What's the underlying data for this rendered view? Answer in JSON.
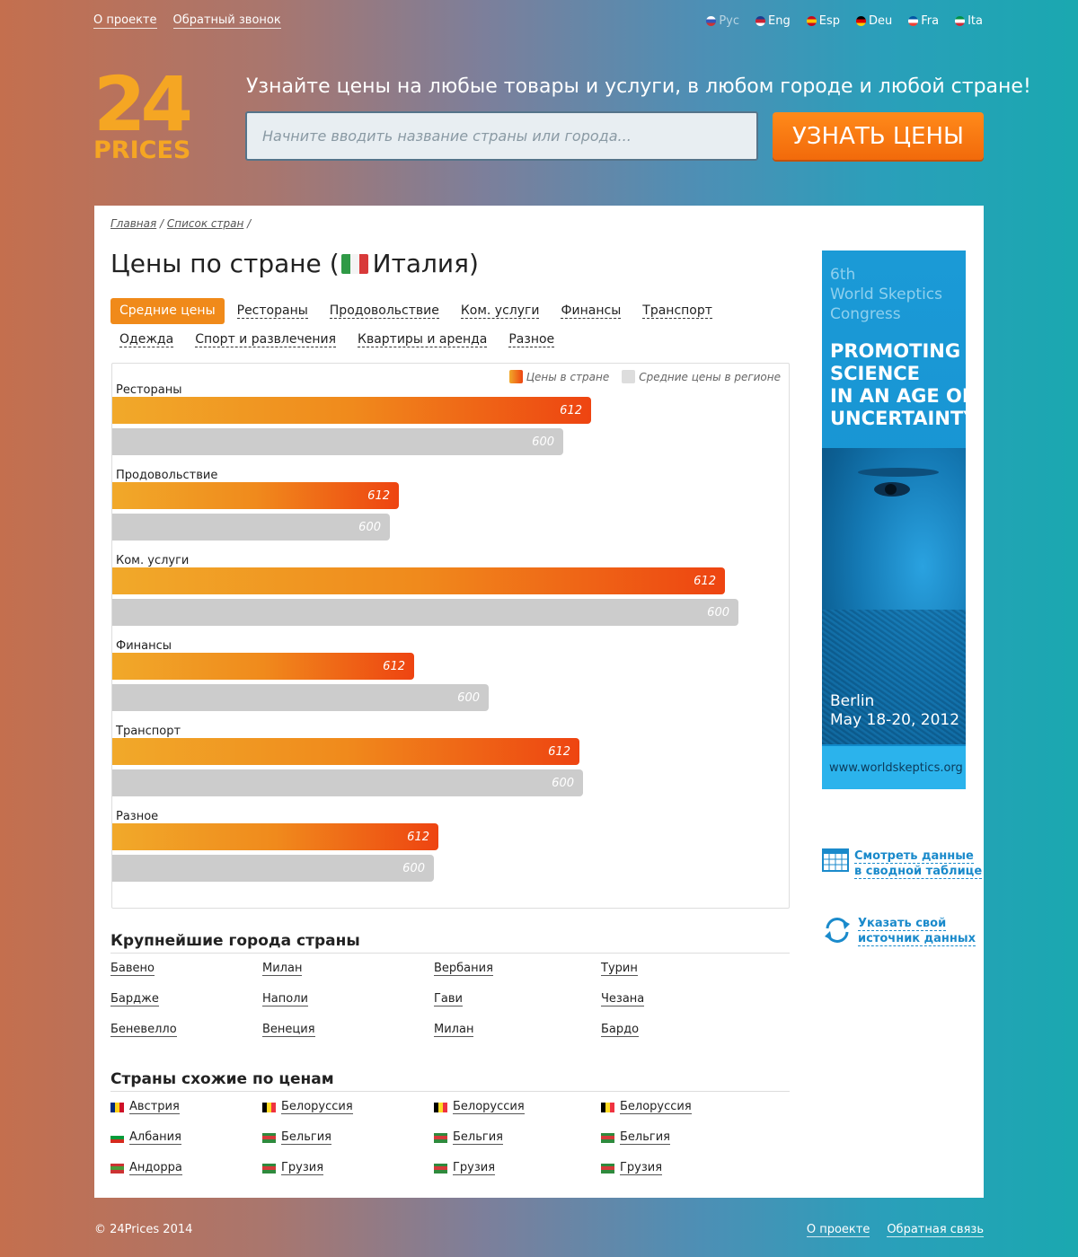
{
  "topnav": {
    "about": "О проекте",
    "callback": "Обратный звонок"
  },
  "languages": [
    {
      "label": "Рус",
      "colors": [
        "#ffffff",
        "#3355bb",
        "#cc3333"
      ]
    },
    {
      "label": "Eng",
      "colors": [
        "#1b3d8f",
        "#cc2233",
        "#ffffff"
      ]
    },
    {
      "label": "Esp",
      "colors": [
        "#c60b1e",
        "#ffc400",
        "#c60b1e"
      ]
    },
    {
      "label": "Deu",
      "colors": [
        "#000000",
        "#dd0000",
        "#ffce00"
      ]
    },
    {
      "label": "Fra",
      "colors": [
        "#0055a4",
        "#ffffff",
        "#ef4135"
      ]
    },
    {
      "label": "Ita",
      "colors": [
        "#009246",
        "#ffffff",
        "#ce2b37"
      ]
    }
  ],
  "logo": {
    "number": "24",
    "word": "PRICES"
  },
  "tagline": "Узнайте цены на любые товары и услуги, в любом городе и любой стране!",
  "search": {
    "placeholder": "Начните вводить название страны или города...",
    "button": "УЗНАТЬ ЦЕНЫ"
  },
  "breadcrumb": {
    "home": "Главная",
    "list": "Список стран",
    "sep": "/"
  },
  "page": {
    "title_prefix": "Цены по стране (",
    "country": "Италия",
    "title_suffix": ")"
  },
  "tabs": [
    {
      "label": "Средние цены",
      "active": true
    },
    {
      "label": "Рестораны"
    },
    {
      "label": "Продовольствие"
    },
    {
      "label": "Ком. услуги"
    },
    {
      "label": "Финансы"
    },
    {
      "label": "Транспорт"
    },
    {
      "label": "Одежда"
    },
    {
      "label": "Спорт и развлечения"
    },
    {
      "label": "Квартиры и аренда"
    },
    {
      "label": "Разное"
    }
  ],
  "chart_data": {
    "type": "bar",
    "orientation": "horizontal",
    "legend": {
      "country": "Цены в стране",
      "region": "Средние цены в регионе",
      "placement": "top-right"
    },
    "colors": {
      "country": "#f08a1c",
      "region": "#cccccc"
    },
    "categories": [
      "Рестораны",
      "Продовольствие",
      "Ком. услуги",
      "Финансы",
      "Транспорт",
      "Разное"
    ],
    "series": [
      {
        "name": "Цены в стране",
        "labels": [
          "612",
          "612",
          "612",
          "612",
          "612",
          "612"
        ],
        "fill": [
          0.708,
          0.424,
          0.906,
          0.446,
          0.69,
          0.482
        ]
      },
      {
        "name": "Средние цены в регионе",
        "labels": [
          "600",
          "600",
          "600",
          "600",
          "600",
          "600"
        ],
        "fill": [
          0.667,
          0.41,
          0.925,
          0.557,
          0.696,
          0.475
        ]
      }
    ]
  },
  "ad": {
    "top": [
      "6th",
      "World Skeptics",
      "Congress"
    ],
    "headline": [
      "PROMOTING",
      "SCIENCE",
      "IN AN AGE OF",
      "UNCERTAINTY"
    ],
    "city": "Berlin",
    "dates": "May 18-20, 2012",
    "url": "www.worldskeptics.org"
  },
  "side_links": {
    "table": [
      "Смотреть данные",
      "в сводной таблице"
    ],
    "source": [
      "Указать свой",
      "источник данных"
    ]
  },
  "cities": {
    "title": "Крупнейшие города страны",
    "columns": [
      [
        "Бавено",
        "Бардже",
        "Беневелло"
      ],
      [
        "Милан",
        "Наполи",
        "Венеция"
      ],
      [
        "Вербания",
        "Гави",
        "Милан"
      ],
      [
        "Турин",
        "Чезана",
        "Бардо"
      ]
    ]
  },
  "similar": {
    "title": "Страны схожие по ценам",
    "columns": [
      [
        {
          "name": "Австрия",
          "flag": [
            "#002b7f",
            "#fcd116",
            "#ce1126"
          ]
        },
        {
          "name": "Албания",
          "flag": [
            "#ffffff",
            "#ffffff",
            "#d52b1e"
          ],
          "horizontal": true,
          "mid": "#009b3a"
        },
        {
          "name": "Андорра",
          "flag": [
            "#cc3333",
            "#4a9a3a",
            "#cc3333"
          ],
          "horizontal": true
        }
      ],
      [
        {
          "name": "Белоруссия",
          "flag": [
            "#000000",
            "#fdda24",
            "#ef3340"
          ]
        },
        {
          "name": "Бельгия",
          "flag": [
            "#2f8a3d",
            "#d63a3a",
            "#2f8a3d"
          ],
          "horizontal": true
        },
        {
          "name": "Грузия",
          "flag": [
            "#2f8a3d",
            "#d63a3a",
            "#2f8a3d"
          ],
          "horizontal": true
        }
      ],
      [
        {
          "name": "Белоруссия",
          "flag": [
            "#000000",
            "#fdda24",
            "#ef3340"
          ]
        },
        {
          "name": "Бельгия",
          "flag": [
            "#2f8a3d",
            "#d63a3a",
            "#2f8a3d"
          ],
          "horizontal": true
        },
        {
          "name": "Грузия",
          "flag": [
            "#2f8a3d",
            "#d63a3a",
            "#2f8a3d"
          ],
          "horizontal": true
        }
      ],
      [
        {
          "name": "Белоруссия",
          "flag": [
            "#000000",
            "#fdda24",
            "#ef3340"
          ]
        },
        {
          "name": "Бельгия",
          "flag": [
            "#2f8a3d",
            "#d63a3a",
            "#2f8a3d"
          ],
          "horizontal": true
        },
        {
          "name": "Грузия",
          "flag": [
            "#2f8a3d",
            "#d63a3a",
            "#2f8a3d"
          ],
          "horizontal": true
        }
      ]
    ]
  },
  "footer": {
    "copyright": "© 24Prices 2014",
    "about": "О проекте",
    "feedback": "Обратная связь"
  }
}
